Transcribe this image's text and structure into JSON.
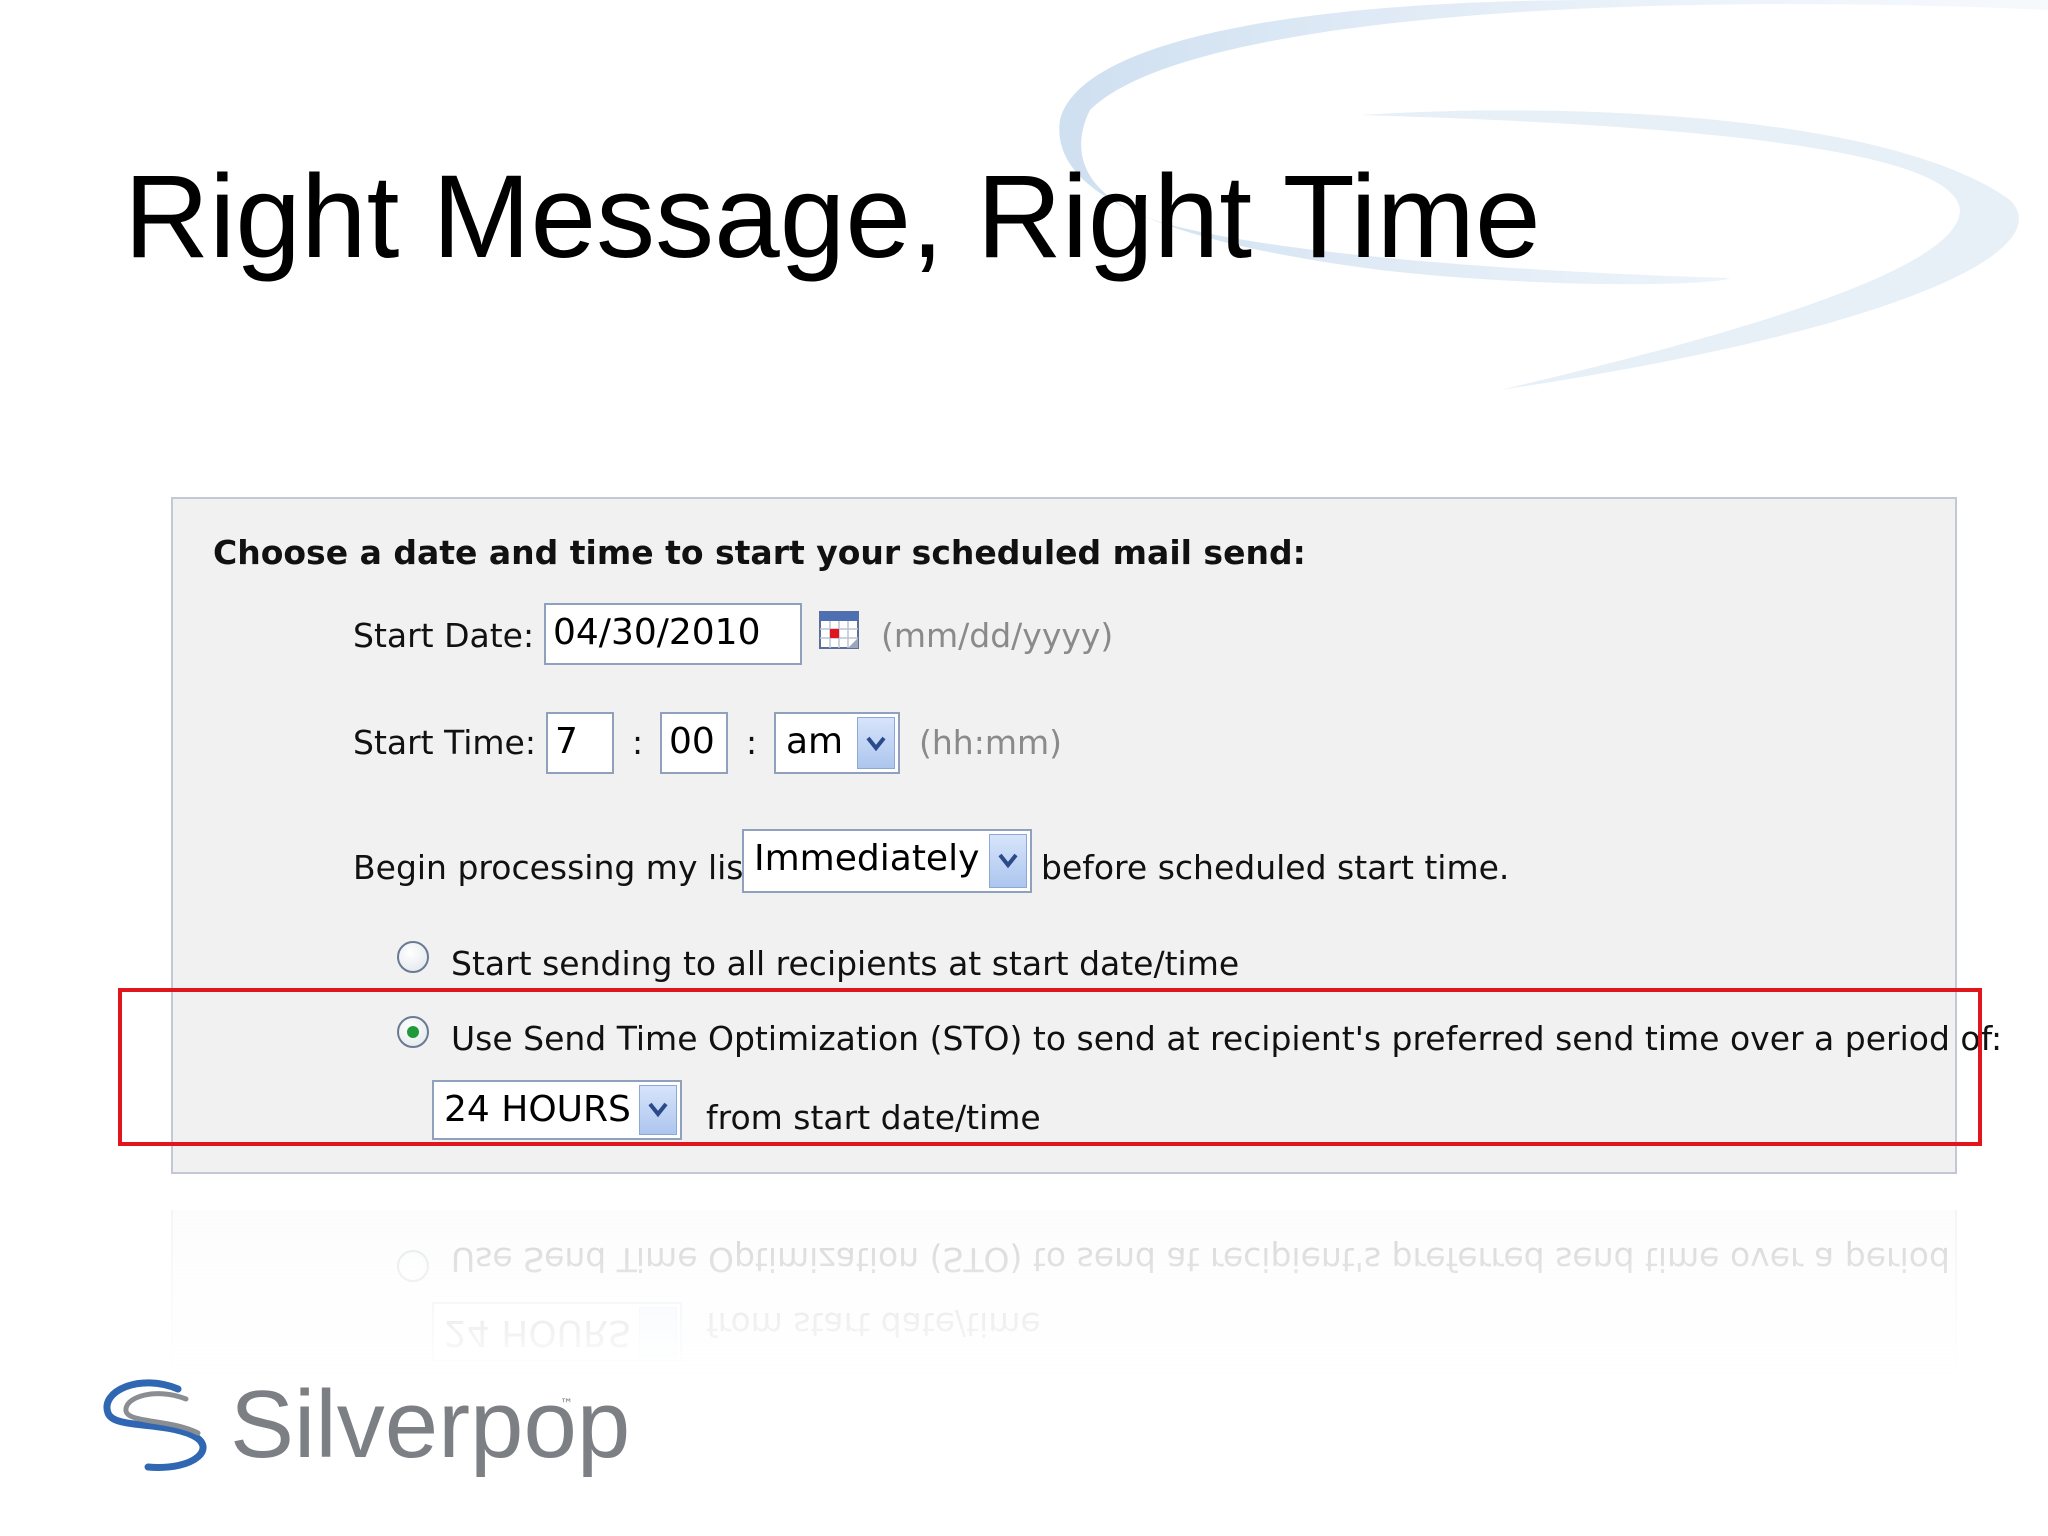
{
  "slide": {
    "title": "Right Message, Right Time"
  },
  "form": {
    "heading": "Choose a date and time to start your scheduled mail send:",
    "start_date_label": "Start Date:",
    "start_date_value": "04/30/2010",
    "date_hint": "(mm/dd/yyyy)",
    "start_time_label": "Start Time:",
    "hour_value": "7",
    "minute_value": "00",
    "colon": ":",
    "ampm_value": "am",
    "time_hint": "(hh:mm)",
    "processing_prefix": "Begin processing my list",
    "processing_value": "Immediately",
    "processing_suffix": "before scheduled start time.",
    "option_all": "Start sending to all recipients at start date/time",
    "option_sto": "Use Send Time Optimization (STO) to send at recipient's preferred send time over a period of:",
    "option_sto_selected": true,
    "period_value": "24 HOURS",
    "period_suffix": "from start date/time"
  },
  "reflection": {
    "period_value": "24 HOURS",
    "period_suffix": "from start date/time",
    "option_sto": "Use Send Time Optimization (STO) to send at recipient's preferred send time over a period of:"
  },
  "logo": {
    "name": "Silverpop",
    "trademark": "™"
  },
  "colors": {
    "highlight": "#e0161c",
    "radio_selected": "#1f9a3a",
    "swoosh": "#c9dcef"
  },
  "icons": {
    "calendar": "calendar-icon",
    "dropdown": "chevron-down-icon"
  }
}
